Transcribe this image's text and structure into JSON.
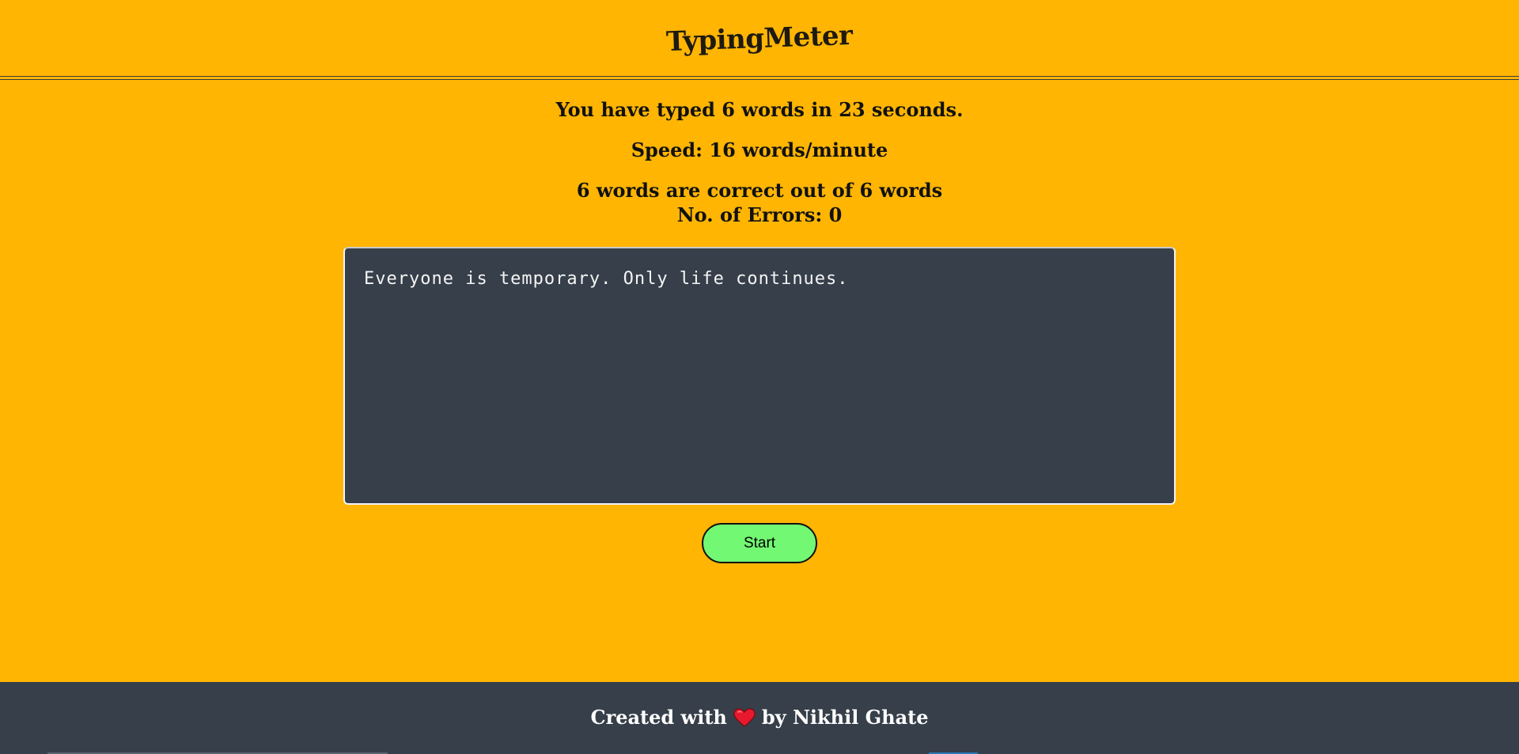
{
  "header": {
    "logo": "TypingMeter"
  },
  "results": {
    "typed_summary": "You have typed 6 words in 23 seconds.",
    "speed": "Speed: 16 words/minute",
    "accuracy": "6 words are correct out of 6 words",
    "errors": "No. of Errors: 0"
  },
  "editor": {
    "value": "Everyone is temporary. Only life continues."
  },
  "controls": {
    "start_label": "Start"
  },
  "footer": {
    "prefix": "Created with",
    "suffix": "by Nikhil Ghate",
    "heart_icon": "heart-icon"
  },
  "colors": {
    "background": "#ffb502",
    "panel": "#363f4a",
    "button": "#72f872",
    "heart": "#e8192c"
  }
}
